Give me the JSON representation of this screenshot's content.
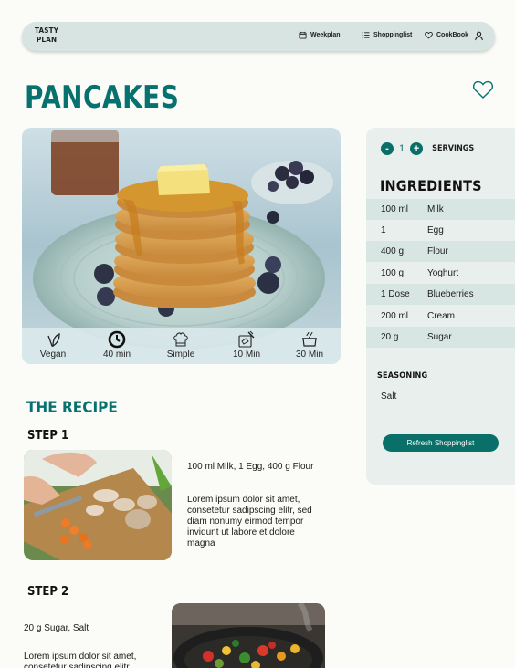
{
  "nav": {
    "logo_line1": "TASTY",
    "logo_line2": "PLAN",
    "weekplan": "Weekplan",
    "shoppinglist": "Shoppinglist",
    "cookbook": "CookBook"
  },
  "recipe": {
    "title": "PANCAKES",
    "info": [
      {
        "icon": "vegan-leaf-icon",
        "label": "Vegan"
      },
      {
        "icon": "clock-icon",
        "label": "40 min"
      },
      {
        "icon": "chef-hat-icon",
        "label": "Simple"
      },
      {
        "icon": "prep-board-icon",
        "label": "10 Min"
      },
      {
        "icon": "cooking-pot-icon",
        "label": "30 Min"
      }
    ]
  },
  "servings": {
    "count": "1",
    "label": "SERVINGS",
    "minus": "-",
    "plus": "+"
  },
  "ingredients": {
    "title": "INGREDIENTS",
    "items": [
      {
        "amount": "100 ml",
        "name": "Milk"
      },
      {
        "amount": "1",
        "name": "Egg"
      },
      {
        "amount": "400 g",
        "name": "Flour"
      },
      {
        "amount": "100 g",
        "name": "Yoghurt"
      },
      {
        "amount": "1 Dose",
        "name": "Blueberries"
      },
      {
        "amount": "200 ml",
        "name": "Cream"
      },
      {
        "amount": "20 g",
        "name": "Sugar"
      }
    ],
    "seasoning_title": "SEASONING",
    "seasoning": [
      "Salt"
    ],
    "refresh_label": "Refresh Shoppinglist"
  },
  "steps": {
    "heading": "THE RECIPE",
    "list": [
      {
        "title": "STEP 1",
        "ingredients": "100 ml Milk, 1 Egg, 400 g Flour",
        "text": "Lorem ipsum dolor sit amet, consetetur sadipscing elitr, sed diam nonumy eirmod tempor invidunt ut labore et dolore magna"
      },
      {
        "title": "STEP 2",
        "ingredients": "20 g Sugar, Salt",
        "text": "Lorem ipsum dolor sit amet, consetetur sadipscing elitr,"
      }
    ]
  },
  "colors": {
    "brand": "#06716f",
    "nav_bg": "#d8e4e2",
    "panel_bg": "#e8efec"
  }
}
